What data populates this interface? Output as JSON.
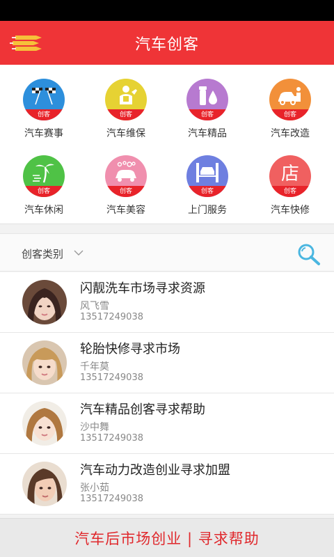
{
  "header": {
    "title": "汽车创客",
    "menu_icon": "menu-icon"
  },
  "categories": [
    {
      "label": "汽车赛事",
      "badge": "创客",
      "icon": "racing-flags-icon",
      "color": "#2d8fdc"
    },
    {
      "label": "汽车维保",
      "badge": "创客",
      "icon": "mechanic-icon",
      "color": "#e6d233"
    },
    {
      "label": "汽车精品",
      "badge": "创客",
      "icon": "oil-products-icon",
      "color": "#b77ad0"
    },
    {
      "label": "汽车改造",
      "badge": "创客",
      "icon": "car-repair-icon",
      "color": "#f2903a"
    },
    {
      "label": "汽车休闲",
      "badge": "创客",
      "icon": "palm-beach-icon",
      "color": "#4fc246"
    },
    {
      "label": "汽车美容",
      "badge": "创客",
      "icon": "car-wash-icon",
      "color": "#f08fae"
    },
    {
      "label": "上门服务",
      "badge": "创客",
      "icon": "car-lift-icon",
      "color": "#6e7fe0"
    },
    {
      "label": "汽车快修",
      "badge": "创客",
      "icon": "shop-icon",
      "color": "#f06060",
      "glyph_text": "店"
    }
  ],
  "filter": {
    "label": "创客类别",
    "search_icon": "search-icon"
  },
  "listings": [
    {
      "title": "闪靓洗车市场寻求资源",
      "name": "风飞雪",
      "phone": "13517249038"
    },
    {
      "title": "轮胎快修寻求市场",
      "name": "千年莫",
      "phone": "13517249038"
    },
    {
      "title": "汽车精品创客寻求帮助",
      "name": "沙中舞",
      "phone": "13517249038"
    },
    {
      "title": "汽车动力改造创业寻求加盟",
      "name": "张小茹",
      "phone": "13517249038"
    }
  ],
  "footer": {
    "text": "汽车后市场创业 | 寻求帮助"
  },
  "colors": {
    "brand_red": "#ef3437",
    "footer_text": "#e0282c"
  }
}
